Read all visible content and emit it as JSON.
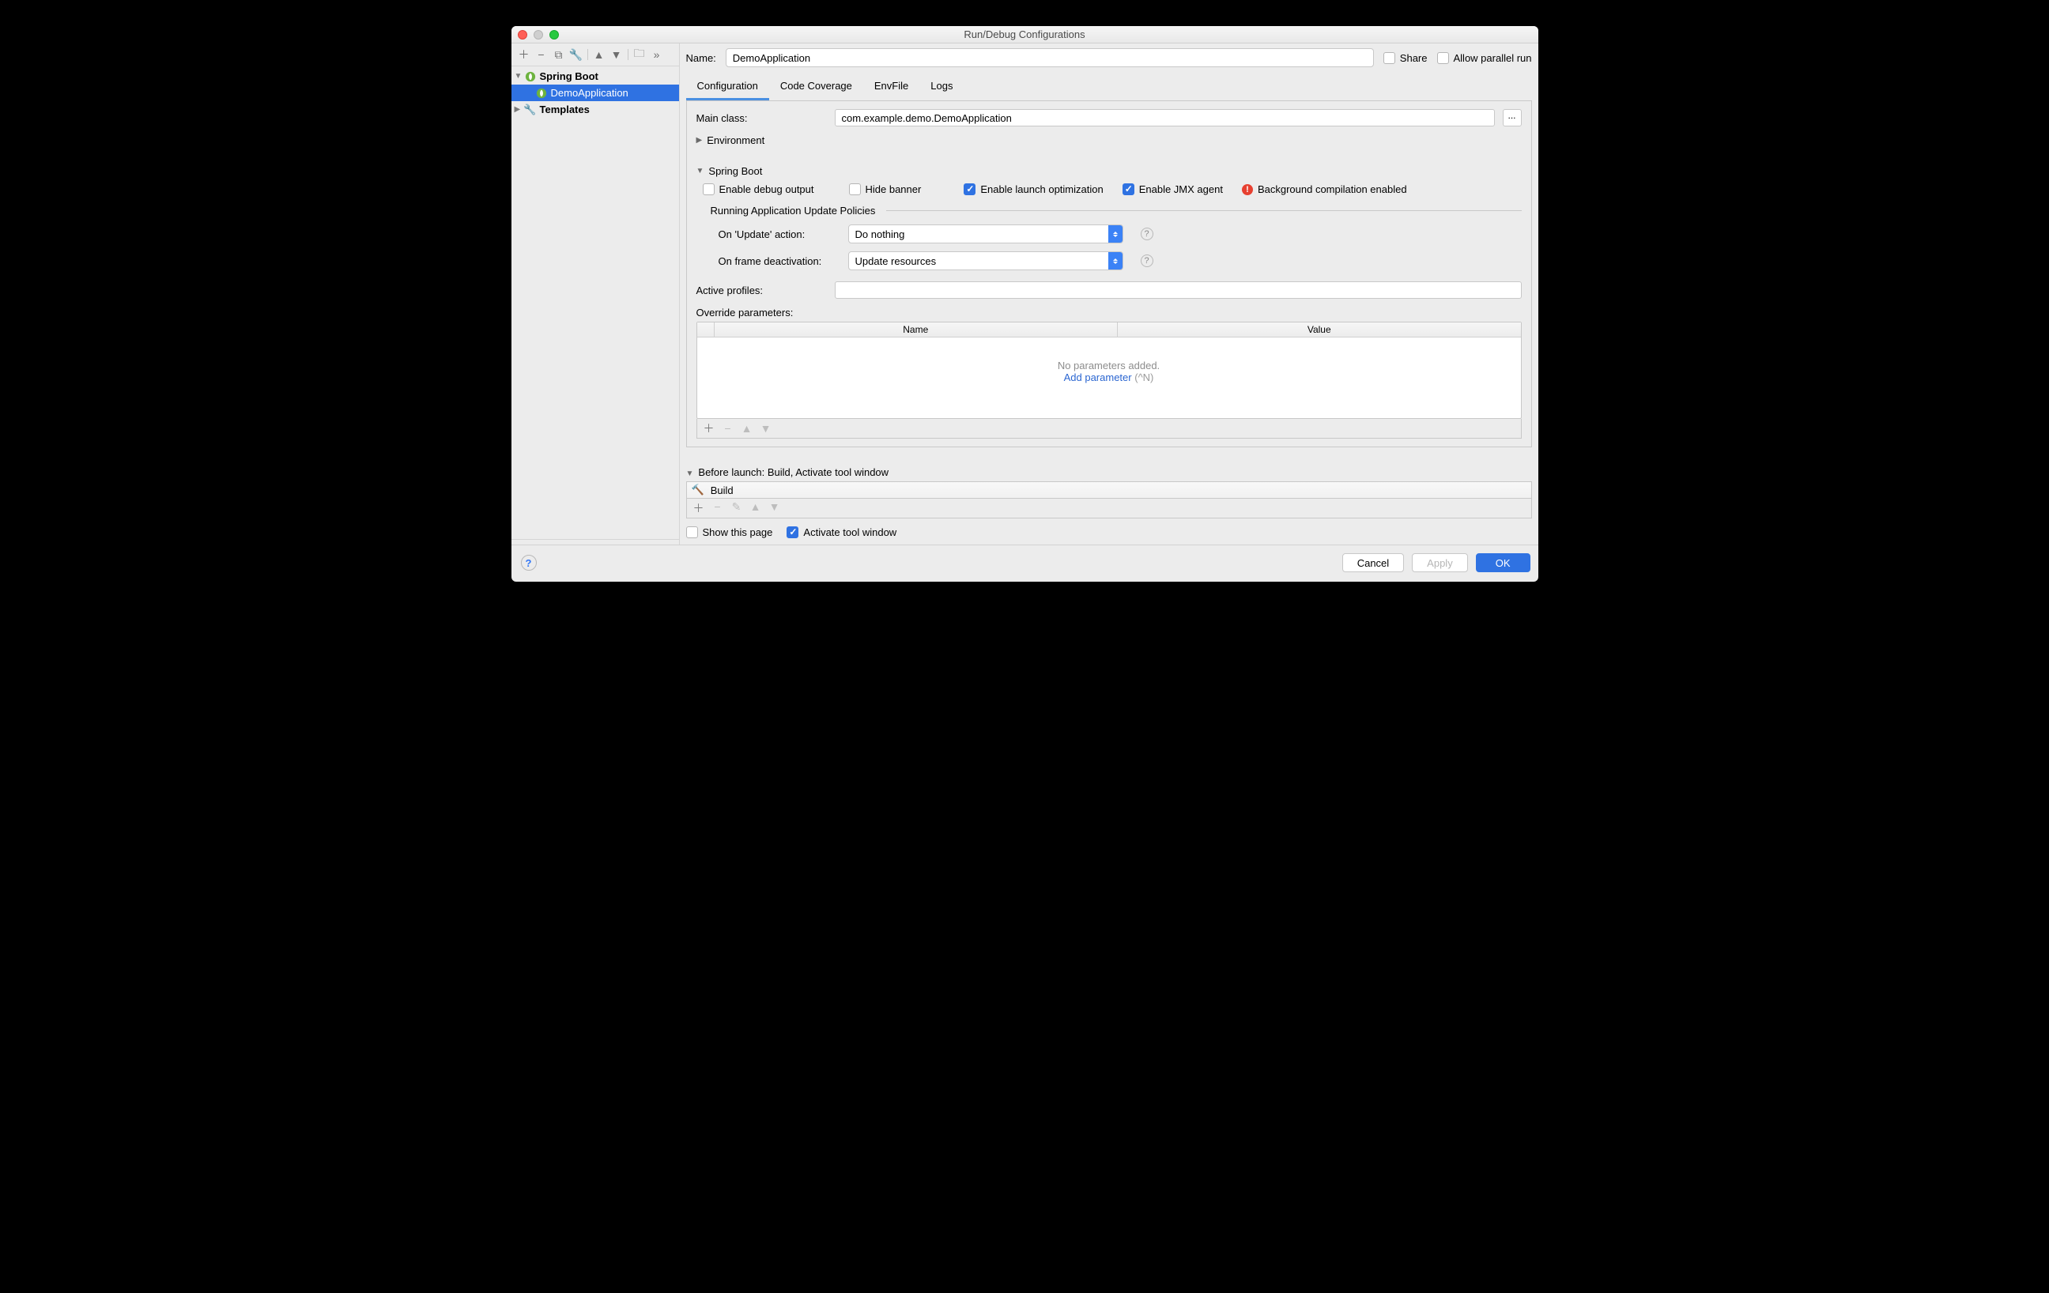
{
  "window": {
    "title": "Run/Debug Configurations"
  },
  "sidebar": {
    "toolbar_icons": [
      "plus",
      "minus",
      "copy",
      "wrench",
      "up",
      "down",
      "folder",
      "expand"
    ],
    "root": {
      "label": "Spring Boot"
    },
    "item": {
      "label": "DemoApplication"
    },
    "templates": {
      "label": "Templates"
    }
  },
  "name_row": {
    "label": "Name:",
    "value": "DemoApplication",
    "share": "Share",
    "parallel": "Allow parallel run"
  },
  "tabs": {
    "configuration": "Configuration",
    "coverage": "Code Coverage",
    "envfile": "EnvFile",
    "logs": "Logs"
  },
  "config": {
    "main_class_label": "Main class:",
    "main_class_value": "com.example.demo.DemoApplication",
    "environment_label": "Environment",
    "spring_boot_label": "Spring Boot",
    "enable_debug": "Enable debug output",
    "hide_banner": "Hide banner",
    "enable_launch": "Enable launch optimization",
    "enable_jmx": "Enable JMX agent",
    "bg_compile": "Background compilation enabled",
    "update_policies_title": "Running Application Update Policies",
    "on_update_label": "On 'Update' action:",
    "on_update_value": "Do nothing",
    "on_frame_label": "On frame deactivation:",
    "on_frame_value": "Update resources",
    "active_profiles_label": "Active profiles:",
    "active_profiles_value": "",
    "override_label": "Override parameters:",
    "col_name": "Name",
    "col_value": "Value",
    "no_params": "No parameters added.",
    "add_param": "Add parameter",
    "add_param_short": "(^N)"
  },
  "before": {
    "title": "Before launch: Build, Activate tool window",
    "item": "Build",
    "show_page": "Show this page",
    "activate": "Activate tool window"
  },
  "footer": {
    "cancel": "Cancel",
    "apply": "Apply",
    "ok": "OK"
  }
}
